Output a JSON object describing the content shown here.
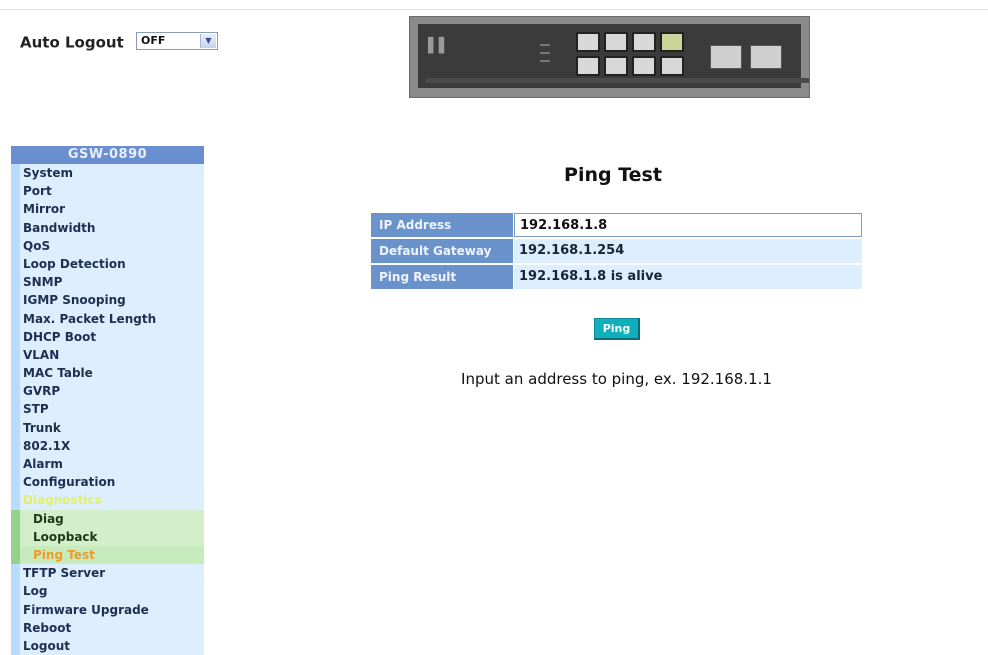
{
  "auto_logout": {
    "label": "Auto Logout",
    "selected": "OFF"
  },
  "sidebar": {
    "title": "GSW-0890",
    "items": [
      {
        "label": "System"
      },
      {
        "label": "Port"
      },
      {
        "label": "Mirror"
      },
      {
        "label": "Bandwidth"
      },
      {
        "label": "QoS"
      },
      {
        "label": "Loop Detection"
      },
      {
        "label": "SNMP"
      },
      {
        "label": "IGMP Snooping"
      },
      {
        "label": "Max. Packet Length"
      },
      {
        "label": "DHCP Boot"
      },
      {
        "label": "VLAN"
      },
      {
        "label": "MAC Table"
      },
      {
        "label": "GVRP"
      },
      {
        "label": "STP"
      },
      {
        "label": "Trunk"
      },
      {
        "label": "802.1X"
      },
      {
        "label": "Alarm"
      },
      {
        "label": "Configuration"
      },
      {
        "label": "Diagnostics"
      }
    ],
    "sub_items": [
      {
        "label": "Diag"
      },
      {
        "label": "Loopback"
      },
      {
        "label": "Ping Test"
      }
    ],
    "items_after": [
      {
        "label": "TFTP Server"
      },
      {
        "label": "Log"
      },
      {
        "label": "Firmware Upgrade"
      },
      {
        "label": "Reboot"
      },
      {
        "label": "Logout"
      }
    ],
    "active_item": "Diagnostics",
    "active_sub_item": "Ping Test"
  },
  "main": {
    "title": "Ping Test",
    "fields": {
      "ip_address": {
        "label": "IP Address",
        "value": "192.168.1.8"
      },
      "default_gateway": {
        "label": "Default Gateway",
        "value": "192.168.1.254"
      },
      "ping_result": {
        "label": "Ping Result",
        "value": "192.168.1.8 is alive"
      }
    },
    "ping_button": "Ping",
    "hint": "Input an address to ping, ex. 192.168.1.1"
  },
  "colors": {
    "sidebar_header": "#6a8fd0",
    "sidebar_item_bg": "#ddeeff",
    "active_item_text": "#e1ef6c",
    "active_sub_text": "#f09a2a",
    "label_bg": "#6a93cc",
    "ping_button": "#11aebc"
  }
}
